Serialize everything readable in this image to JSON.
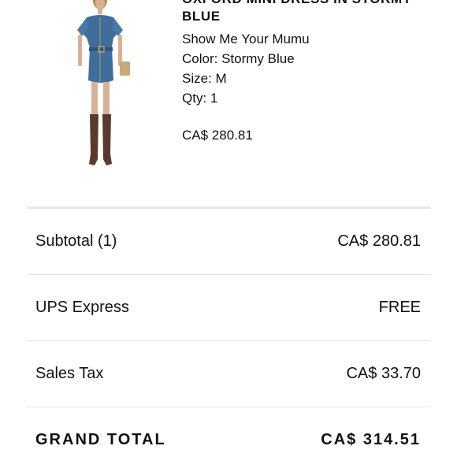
{
  "product": {
    "image_icon": "dress-product-image",
    "name": "OXFORD MINI DRESS IN STORMY BLUE",
    "brand": "Show Me Your Mumu",
    "color": "Color: Stormy Blue",
    "size": "Size: M",
    "qty": "Qty: 1",
    "price": "CA$ 280.81"
  },
  "summary": {
    "subtotal_label": "Subtotal (1)",
    "subtotal_value": "CA$ 280.81",
    "shipping_label": "UPS Express",
    "shipping_value": "FREE",
    "tax_label": "Sales Tax",
    "tax_value": "CA$ 33.70",
    "grand_total_label": "GRAND TOTAL",
    "grand_total_value": "CA$ 314.51"
  },
  "colors": {
    "denim": "#3f6e9c",
    "boots": "#5b3a2c",
    "divider": "#e2e2e2"
  }
}
